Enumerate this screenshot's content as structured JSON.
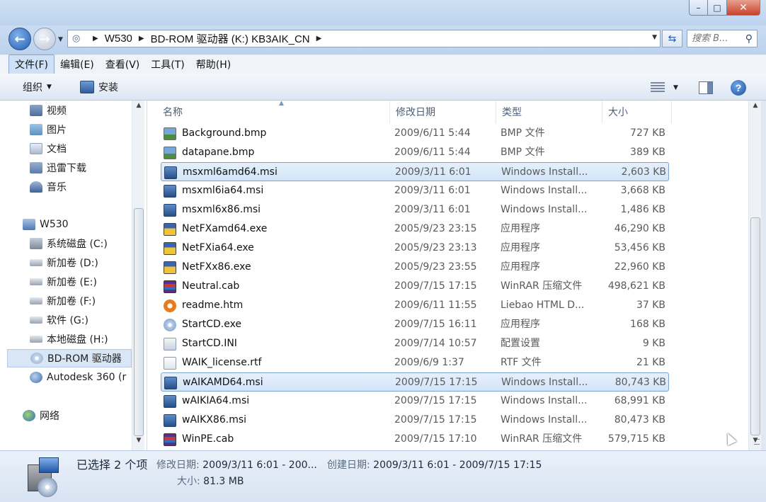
{
  "window": {
    "minimize_glyph": "–",
    "maximize_glyph": "□",
    "close_glyph": "✕"
  },
  "address": {
    "crumbs": [
      "W530",
      "BD-ROM 驱动器 (K:) KB3AIK_CN"
    ],
    "search_placeholder": "搜索 B..."
  },
  "menu": [
    "文件(F)",
    "编辑(E)",
    "查看(V)",
    "工具(T)",
    "帮助(H)"
  ],
  "toolbar": {
    "organize_label": "组织",
    "install_label": "安装"
  },
  "nav": {
    "items": [
      {
        "label": "视频",
        "icon": "video-library-icon"
      },
      {
        "label": "图片",
        "icon": "pictures-library-icon"
      },
      {
        "label": "文档",
        "icon": "documents-library-icon"
      },
      {
        "label": "迅雷下载",
        "icon": "downloads-folder-icon"
      },
      {
        "label": "音乐",
        "icon": "music-library-icon"
      },
      {
        "label": "W530",
        "icon": "computer-icon"
      },
      {
        "label": "系统磁盘 (C:)",
        "icon": "system-drive-icon"
      },
      {
        "label": "新加卷 (D:)",
        "icon": "hard-drive-icon"
      },
      {
        "label": "新加卷 (E:)",
        "icon": "hard-drive-icon"
      },
      {
        "label": "新加卷 (F:)",
        "icon": "hard-drive-icon"
      },
      {
        "label": "软件 (G:)",
        "icon": "hard-drive-icon"
      },
      {
        "label": "本地磁盘 (H:)",
        "icon": "hard-drive-icon"
      },
      {
        "label": "BD-ROM 驱动器",
        "icon": "optical-drive-icon"
      },
      {
        "label": "Autodesk 360 (r",
        "icon": "cloud-drive-icon"
      },
      {
        "label": "网络",
        "icon": "network-icon"
      }
    ]
  },
  "columns": {
    "name": "名称",
    "date": "修改日期",
    "type": "类型",
    "size": "大小"
  },
  "files": [
    {
      "name": "Background.bmp",
      "date": "2009/6/11 5:44",
      "type": "BMP 文件",
      "size": "727 KB",
      "icon": "bitmap-file-icon",
      "selected": false
    },
    {
      "name": "datapane.bmp",
      "date": "2009/6/11 5:44",
      "type": "BMP 文件",
      "size": "389 KB",
      "icon": "bitmap-file-icon",
      "selected": false
    },
    {
      "name": "msxml6amd64.msi",
      "date": "2009/3/11 6:01",
      "type": "Windows Install...",
      "size": "2,603 KB",
      "icon": "installer-package-icon",
      "selected": true
    },
    {
      "name": "msxml6ia64.msi",
      "date": "2009/3/11 6:01",
      "type": "Windows Install...",
      "size": "3,668 KB",
      "icon": "installer-package-icon",
      "selected": false
    },
    {
      "name": "msxml6x86.msi",
      "date": "2009/3/11 6:01",
      "type": "Windows Install...",
      "size": "1,486 KB",
      "icon": "installer-package-icon",
      "selected": false
    },
    {
      "name": "NetFXamd64.exe",
      "date": "2005/9/23 23:15",
      "type": "应用程序",
      "size": "46,290 KB",
      "icon": "setup-exe-icon",
      "selected": false
    },
    {
      "name": "NetFXia64.exe",
      "date": "2005/9/23 23:13",
      "type": "应用程序",
      "size": "53,456 KB",
      "icon": "setup-exe-icon",
      "selected": false
    },
    {
      "name": "NetFXx86.exe",
      "date": "2005/9/23 23:55",
      "type": "应用程序",
      "size": "22,960 KB",
      "icon": "setup-exe-icon",
      "selected": false
    },
    {
      "name": "Neutral.cab",
      "date": "2009/7/15 17:15",
      "type": "WinRAR 压缩文件",
      "size": "498,621 KB",
      "icon": "winrar-archive-icon",
      "selected": false
    },
    {
      "name": "readme.htm",
      "date": "2009/6/11 11:55",
      "type": "Liebao HTML D...",
      "size": "37 KB",
      "icon": "html-document-icon",
      "selected": false
    },
    {
      "name": "StartCD.exe",
      "date": "2009/7/15 16:11",
      "type": "应用程序",
      "size": "168 KB",
      "icon": "cd-app-icon",
      "selected": false
    },
    {
      "name": "StartCD.INI",
      "date": "2009/7/14 10:57",
      "type": "配置设置",
      "size": "9 KB",
      "icon": "config-file-icon",
      "selected": false
    },
    {
      "name": "WAIK_license.rtf",
      "date": "2009/6/9 1:37",
      "type": "RTF 文件",
      "size": "21 KB",
      "icon": "rtf-document-icon",
      "selected": false
    },
    {
      "name": "wAIKAMD64.msi",
      "date": "2009/7/15 17:15",
      "type": "Windows Install...",
      "size": "80,743 KB",
      "icon": "installer-package-icon",
      "selected": true
    },
    {
      "name": "wAIKIA64.msi",
      "date": "2009/7/15 17:15",
      "type": "Windows Install...",
      "size": "68,991 KB",
      "icon": "installer-package-icon",
      "selected": false
    },
    {
      "name": "wAIKX86.msi",
      "date": "2009/7/15 17:15",
      "type": "Windows Install...",
      "size": "80,473 KB",
      "icon": "installer-package-icon",
      "selected": false
    },
    {
      "name": "WinPE.cab",
      "date": "2009/7/15 17:10",
      "type": "WinRAR 压缩文件",
      "size": "579,715 KB",
      "icon": "winrar-archive-icon",
      "selected": false
    }
  ],
  "details": {
    "title": "已选择 2 个项",
    "modified_label": "修改日期:",
    "modified_value": "2009/3/11 6:01 - 200...",
    "created_label": "创建日期:",
    "created_value": "2009/3/11 6:01 - 2009/7/15 17:15",
    "size_label": "大小:",
    "size_value": "81.3 MB"
  }
}
